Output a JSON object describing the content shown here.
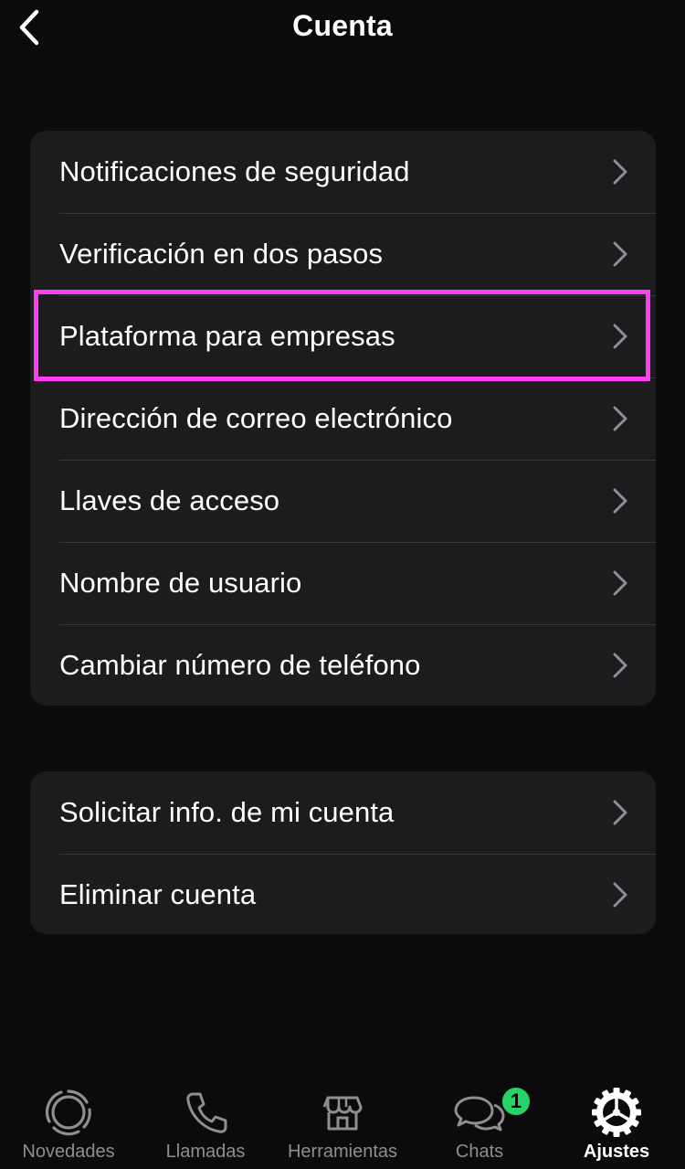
{
  "header": {
    "title": "Cuenta",
    "back_icon": "chevron-left-icon"
  },
  "groups": [
    {
      "items": [
        {
          "label": "Notificaciones de seguridad"
        },
        {
          "label": "Verificación en dos pasos"
        },
        {
          "label": "Plataforma para empresas",
          "highlighted": true
        },
        {
          "label": "Dirección de correo electrónico"
        },
        {
          "label": "Llaves de acceso"
        },
        {
          "label": "Nombre de usuario"
        },
        {
          "label": "Cambiar número de teléfono"
        }
      ]
    },
    {
      "items": [
        {
          "label": "Solicitar info. de mi cuenta"
        },
        {
          "label": "Eliminar cuenta"
        }
      ]
    }
  ],
  "tabbar": {
    "tabs": [
      {
        "label": "Novedades",
        "icon": "status-icon",
        "active": false
      },
      {
        "label": "Llamadas",
        "icon": "phone-icon",
        "active": false
      },
      {
        "label": "Herramientas",
        "icon": "store-icon",
        "active": false
      },
      {
        "label": "Chats",
        "icon": "chat-bubbles-icon",
        "active": false,
        "badge": "1"
      },
      {
        "label": "Ajustes",
        "icon": "gear-icon",
        "active": true
      }
    ]
  },
  "colors": {
    "background": "#0b0b0b",
    "group_background": "#1c1c1e",
    "highlight": "#ff3df2",
    "badge": "#25d366",
    "inactive_tab": "#8e8e93"
  }
}
